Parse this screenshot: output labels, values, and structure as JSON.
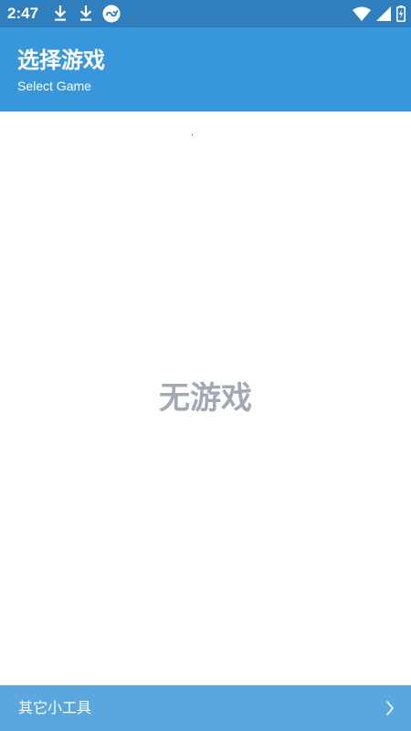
{
  "status_bar": {
    "time": "2:47",
    "icons": [
      "download-icon",
      "download-icon",
      "cloud-sync-icon",
      "wifi-icon",
      "signal-icon",
      "battery-charging-icon"
    ],
    "background": "#2f7fbf"
  },
  "app_bar": {
    "title": "选择游戏",
    "subtitle": "Select Game",
    "background": "#3897db"
  },
  "content": {
    "empty_message": "无游戏"
  },
  "bottom_bar": {
    "label": "其它小工具",
    "icon": "chevron-right-icon",
    "background": "#5aa6dd"
  }
}
